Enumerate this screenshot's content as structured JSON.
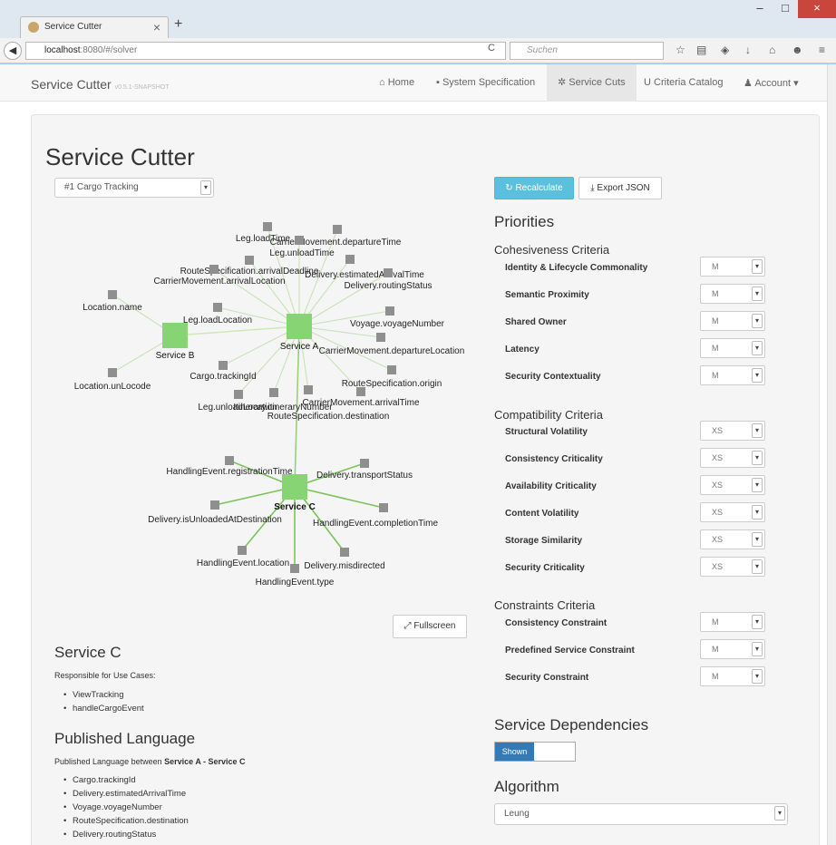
{
  "browser": {
    "tab_title": "Service Cutter",
    "url_host": "localhost",
    "url_path": ":8080/#/solver",
    "search_placeholder": "Suchen"
  },
  "nav": {
    "brand": "Service Cutter",
    "version": "v0.5.1-SNAPSHOT",
    "items": [
      "Home",
      "System Specification",
      "Service Cuts",
      "Criteria Catalog",
      "Account"
    ]
  },
  "page": {
    "title": "Service Cutter",
    "spec_select": "#1 Cargo Tracking",
    "recalc": "Recalculate",
    "export": "Export JSON",
    "fullscreen": "Fullscreen"
  },
  "graph": {
    "services": [
      "Service B",
      "Service A",
      "Service C"
    ],
    "labels": [
      "Leg.loadTime",
      "CarrierMovement.departureTime",
      "Leg.unloadTime",
      "RouteSpecification.arrivalDeadline",
      "Delivery.estimatedArrivalTime",
      "CarrierMovement.arrivalLocation",
      "Delivery.routingStatus",
      "Location.name",
      "Leg.loadLocation",
      "Voyage.voyageNumber",
      "CarrierMovement.departureLocation",
      "Location.unLocode",
      "Cargo.trackingId",
      "RouteSpecification.origin",
      "Leg.unloadLocation",
      "Itinerary.itineraryNumber",
      "CarrierMovement.arrivalTime",
      "RouteSpecification.destination",
      "HandlingEvent.registrationTime",
      "Delivery.transportStatus",
      "Delivery.isUnloadedAtDestination",
      "HandlingEvent.completionTime",
      "HandlingEvent.location",
      "Delivery.misdirected",
      "HandlingEvent.type"
    ]
  },
  "priorities": {
    "title": "Priorities",
    "groups": [
      {
        "title": "Cohesiveness Criteria",
        "items": [
          {
            "label": "Identity & Lifecycle Commonality",
            "value": "M"
          },
          {
            "label": "Semantic Proximity",
            "value": "M"
          },
          {
            "label": "Shared Owner",
            "value": "M"
          },
          {
            "label": "Latency",
            "value": "M"
          },
          {
            "label": "Security Contextuality",
            "value": "M"
          }
        ]
      },
      {
        "title": "Compatibility Criteria",
        "items": [
          {
            "label": "Structural Volatility",
            "value": "XS"
          },
          {
            "label": "Consistency Criticality",
            "value": "XS"
          },
          {
            "label": "Availability Criticality",
            "value": "XS"
          },
          {
            "label": "Content Volatility",
            "value": "XS"
          },
          {
            "label": "Storage Similarity",
            "value": "XS"
          },
          {
            "label": "Security Criticality",
            "value": "XS"
          }
        ]
      },
      {
        "title": "Constraints Criteria",
        "items": [
          {
            "label": "Consistency Constraint",
            "value": "M"
          },
          {
            "label": "Predefined Service Constraint",
            "value": "M"
          },
          {
            "label": "Security Constraint",
            "value": "M"
          }
        ]
      }
    ]
  },
  "dependencies": {
    "title": "Service Dependencies",
    "toggle": "Shown"
  },
  "algorithm": {
    "title": "Algorithm",
    "value": "Leung"
  },
  "service_detail": {
    "title": "Service C",
    "use_cases_label": "Responsible for Use Cases:",
    "use_cases": [
      "ViewTracking",
      "handleCargoEvent"
    ]
  },
  "published": {
    "title": "Published Language",
    "intro": "Published Language between",
    "between": "Service A - Service C",
    "items": [
      "Cargo.trackingId",
      "Delivery.estimatedArrivalTime",
      "Voyage.voyageNumber",
      "RouteSpecification.destination",
      "Delivery.routingStatus"
    ]
  }
}
